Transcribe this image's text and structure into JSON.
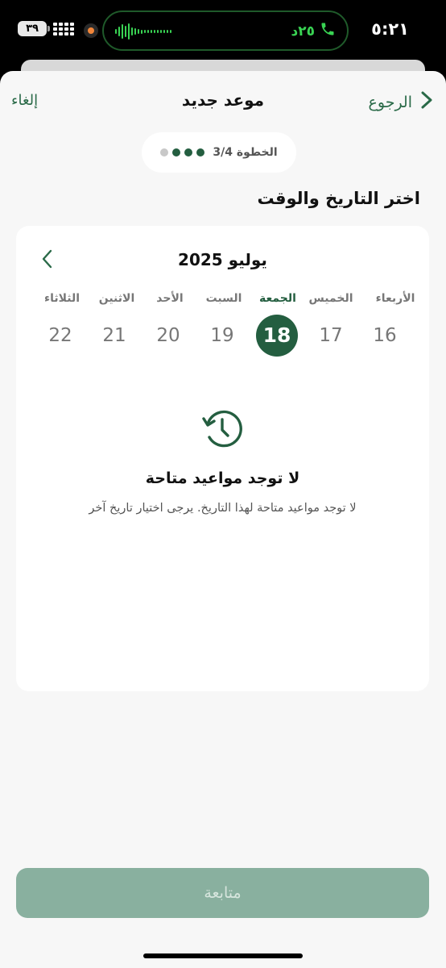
{
  "status_bar": {
    "time": "٥:٢١",
    "call_duration": "٢٥د",
    "battery": "٣٩"
  },
  "nav": {
    "back_label": "الرجوع",
    "title": "موعد جديد",
    "cancel_label": "إلغاء"
  },
  "step": {
    "label": "الخطوة 3/4",
    "current": 3,
    "total": 4
  },
  "section_title": "اختر التاريخ والوقت",
  "calendar": {
    "month_label": "يوليو 2025",
    "days": [
      {
        "name": "الأربعاء",
        "num": "16",
        "selected": false
      },
      {
        "name": "الخميس",
        "num": "17",
        "selected": false
      },
      {
        "name": "الجمعة",
        "num": "18",
        "selected": true
      },
      {
        "name": "السبت",
        "num": "19",
        "selected": false
      },
      {
        "name": "الأحد",
        "num": "20",
        "selected": false
      },
      {
        "name": "الاثنين",
        "num": "21",
        "selected": false
      },
      {
        "name": "الثلاثاء",
        "num": "22",
        "selected": false
      }
    ]
  },
  "empty_state": {
    "icon": "history-clock-icon",
    "title": "لا توجد مواعيد متاحة",
    "subtitle": "لا توجد مواعيد متاحة لهذا التاريخ. يرجى اختيار تاريخ آخر"
  },
  "continue_label": "متابعة",
  "colors": {
    "accent": "#245e40",
    "disabled_button": "#89b09f",
    "call_green": "#39d353"
  }
}
